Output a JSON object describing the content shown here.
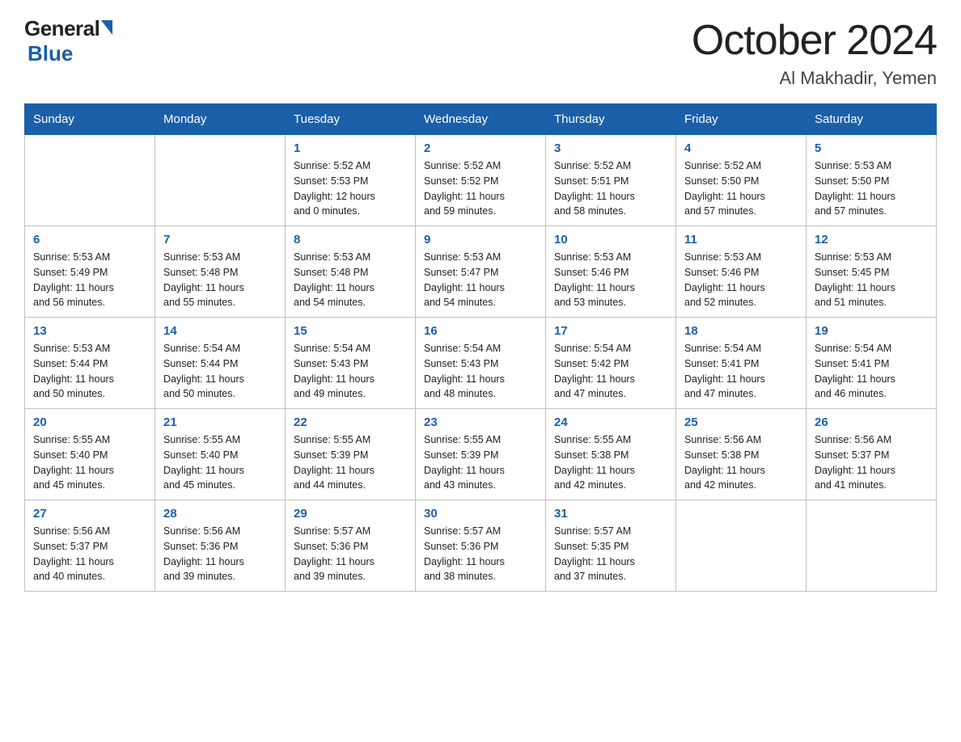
{
  "logo": {
    "general": "General",
    "blue": "Blue"
  },
  "title": "October 2024",
  "subtitle": "Al Makhadir, Yemen",
  "days_of_week": [
    "Sunday",
    "Monday",
    "Tuesday",
    "Wednesday",
    "Thursday",
    "Friday",
    "Saturday"
  ],
  "weeks": [
    [
      {
        "day": "",
        "info": ""
      },
      {
        "day": "",
        "info": ""
      },
      {
        "day": "1",
        "info": "Sunrise: 5:52 AM\nSunset: 5:53 PM\nDaylight: 12 hours\nand 0 minutes."
      },
      {
        "day": "2",
        "info": "Sunrise: 5:52 AM\nSunset: 5:52 PM\nDaylight: 11 hours\nand 59 minutes."
      },
      {
        "day": "3",
        "info": "Sunrise: 5:52 AM\nSunset: 5:51 PM\nDaylight: 11 hours\nand 58 minutes."
      },
      {
        "day": "4",
        "info": "Sunrise: 5:52 AM\nSunset: 5:50 PM\nDaylight: 11 hours\nand 57 minutes."
      },
      {
        "day": "5",
        "info": "Sunrise: 5:53 AM\nSunset: 5:50 PM\nDaylight: 11 hours\nand 57 minutes."
      }
    ],
    [
      {
        "day": "6",
        "info": "Sunrise: 5:53 AM\nSunset: 5:49 PM\nDaylight: 11 hours\nand 56 minutes."
      },
      {
        "day": "7",
        "info": "Sunrise: 5:53 AM\nSunset: 5:48 PM\nDaylight: 11 hours\nand 55 minutes."
      },
      {
        "day": "8",
        "info": "Sunrise: 5:53 AM\nSunset: 5:48 PM\nDaylight: 11 hours\nand 54 minutes."
      },
      {
        "day": "9",
        "info": "Sunrise: 5:53 AM\nSunset: 5:47 PM\nDaylight: 11 hours\nand 54 minutes."
      },
      {
        "day": "10",
        "info": "Sunrise: 5:53 AM\nSunset: 5:46 PM\nDaylight: 11 hours\nand 53 minutes."
      },
      {
        "day": "11",
        "info": "Sunrise: 5:53 AM\nSunset: 5:46 PM\nDaylight: 11 hours\nand 52 minutes."
      },
      {
        "day": "12",
        "info": "Sunrise: 5:53 AM\nSunset: 5:45 PM\nDaylight: 11 hours\nand 51 minutes."
      }
    ],
    [
      {
        "day": "13",
        "info": "Sunrise: 5:53 AM\nSunset: 5:44 PM\nDaylight: 11 hours\nand 50 minutes."
      },
      {
        "day": "14",
        "info": "Sunrise: 5:54 AM\nSunset: 5:44 PM\nDaylight: 11 hours\nand 50 minutes."
      },
      {
        "day": "15",
        "info": "Sunrise: 5:54 AM\nSunset: 5:43 PM\nDaylight: 11 hours\nand 49 minutes."
      },
      {
        "day": "16",
        "info": "Sunrise: 5:54 AM\nSunset: 5:43 PM\nDaylight: 11 hours\nand 48 minutes."
      },
      {
        "day": "17",
        "info": "Sunrise: 5:54 AM\nSunset: 5:42 PM\nDaylight: 11 hours\nand 47 minutes."
      },
      {
        "day": "18",
        "info": "Sunrise: 5:54 AM\nSunset: 5:41 PM\nDaylight: 11 hours\nand 47 minutes."
      },
      {
        "day": "19",
        "info": "Sunrise: 5:54 AM\nSunset: 5:41 PM\nDaylight: 11 hours\nand 46 minutes."
      }
    ],
    [
      {
        "day": "20",
        "info": "Sunrise: 5:55 AM\nSunset: 5:40 PM\nDaylight: 11 hours\nand 45 minutes."
      },
      {
        "day": "21",
        "info": "Sunrise: 5:55 AM\nSunset: 5:40 PM\nDaylight: 11 hours\nand 45 minutes."
      },
      {
        "day": "22",
        "info": "Sunrise: 5:55 AM\nSunset: 5:39 PM\nDaylight: 11 hours\nand 44 minutes."
      },
      {
        "day": "23",
        "info": "Sunrise: 5:55 AM\nSunset: 5:39 PM\nDaylight: 11 hours\nand 43 minutes."
      },
      {
        "day": "24",
        "info": "Sunrise: 5:55 AM\nSunset: 5:38 PM\nDaylight: 11 hours\nand 42 minutes."
      },
      {
        "day": "25",
        "info": "Sunrise: 5:56 AM\nSunset: 5:38 PM\nDaylight: 11 hours\nand 42 minutes."
      },
      {
        "day": "26",
        "info": "Sunrise: 5:56 AM\nSunset: 5:37 PM\nDaylight: 11 hours\nand 41 minutes."
      }
    ],
    [
      {
        "day": "27",
        "info": "Sunrise: 5:56 AM\nSunset: 5:37 PM\nDaylight: 11 hours\nand 40 minutes."
      },
      {
        "day": "28",
        "info": "Sunrise: 5:56 AM\nSunset: 5:36 PM\nDaylight: 11 hours\nand 39 minutes."
      },
      {
        "day": "29",
        "info": "Sunrise: 5:57 AM\nSunset: 5:36 PM\nDaylight: 11 hours\nand 39 minutes."
      },
      {
        "day": "30",
        "info": "Sunrise: 5:57 AM\nSunset: 5:36 PM\nDaylight: 11 hours\nand 38 minutes."
      },
      {
        "day": "31",
        "info": "Sunrise: 5:57 AM\nSunset: 5:35 PM\nDaylight: 11 hours\nand 37 minutes."
      },
      {
        "day": "",
        "info": ""
      },
      {
        "day": "",
        "info": ""
      }
    ]
  ]
}
